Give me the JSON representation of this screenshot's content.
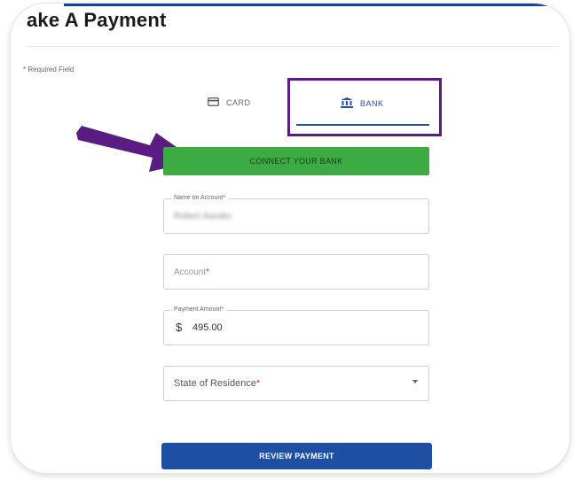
{
  "header": {
    "title": "ake A Payment"
  },
  "form": {
    "required_note": "* Required Field",
    "tabs": [
      {
        "label": "CARD",
        "icon": "credit-card-icon",
        "active": false
      },
      {
        "label": "BANK",
        "icon": "bank-icon",
        "active": true
      }
    ],
    "connect_button_label": "CONNECT YOUR BANK",
    "fields": {
      "name": {
        "label": "Name on Account",
        "required_mark": "*",
        "value": "Robert Aacaks"
      },
      "account": {
        "placeholder": "Account",
        "required_mark": "*",
        "value": ""
      },
      "amount": {
        "label": "Payment Amount",
        "required_mark": "*",
        "currency": "$",
        "value": "495.00"
      },
      "state": {
        "placeholder": "State of Residence",
        "required_mark": "*",
        "value": ""
      }
    },
    "review_button_label": "REVIEW PAYMENT"
  },
  "colors": {
    "connect_green": "#3cab44",
    "review_blue": "#1e4fa3",
    "tab_active_blue": "#2a4fa8",
    "annotation_purple": "#5a1b82"
  }
}
